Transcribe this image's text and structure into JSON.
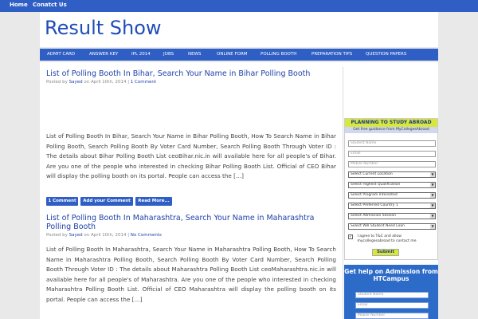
{
  "topnav": {
    "home": "Home",
    "contact": "Conatct Us"
  },
  "site": {
    "title": "Result Show"
  },
  "nav": [
    "ADMIT CARD",
    "ANSWER KEY",
    "IPL 2014",
    "JOBS",
    "NEWS",
    "ONLINE FORM",
    "POLLING BOOTH",
    "PREPARATION TIPS",
    "QUESTION PAPERS"
  ],
  "posts": [
    {
      "title": "List of Polling Booth In Bihar, Search Your Name in Bihar Polling Booth",
      "meta_prefix": "Posted by",
      "author": "Sayed",
      "date": "on April 10th, 2014 |",
      "comments": "1 Comment",
      "body": "List of Polling Booth In Bihar, Search Your Name in Bihar Polling Booth, How To Search Name in Bihar Polling Booth, Search Polling Booth By Voter Card Number, Search Polling Booth Through Voter ID : The details about Bihar Polling Booth List ceoBihar.nic.in will available here for all people's of Bihar. Are you one of the people who interested in checking Bihar Polling Booth List. Official of CEO Bihar will display the polling booth on its portal. People can access the […]",
      "buttons": [
        "1 Comment",
        "Add your Comment",
        "Read More..."
      ]
    },
    {
      "title": "List of Polling Booth In Maharashtra, Search Your Name in Maharashtra Polling Booth",
      "meta_prefix": "Posted by",
      "author": "Sayed",
      "date": "on April 10th, 2014 |",
      "comments": "No Comments",
      "body": "List of Polling Booth In Maharashtra, Search Your Name in Maharashtra Polling Booth, How To Search Name in Maharashtra Polling Booth, Search Polling Booth By Voter Card Number, Search Polling Booth Through Voter ID : The details about Maharashtra Polling Booth List ceoMaharashtra.nic.in will available here for all people's of Maharashtra. Are you one of the people who interested in checking Maharashtra Polling Booth List. Official of CEO Maharashtra will display the polling booth on its portal. People can access the […]"
    }
  ],
  "ad1": {
    "title": "PLANNING TO STUDY ABROAD",
    "subtitle": "Get free guidance from MyCollegesAbroad",
    "fields": [
      "Student Name",
      "Email",
      "Mobile Number"
    ],
    "selects": [
      "Select Current Location",
      "Select Highest Qualification",
      "Select Program Interested",
      "Select Preferred Country 1",
      "Select Admission Session",
      "Select Will Student Need Loan"
    ],
    "agree": "I agree to T&C and allow mycollegesabroad to contact me",
    "submit": "Submit"
  },
  "ad2": {
    "title": "Get help on Admission from HTCampus",
    "fields": [
      "Student Name",
      "Email",
      "Mobile Number"
    ]
  }
}
